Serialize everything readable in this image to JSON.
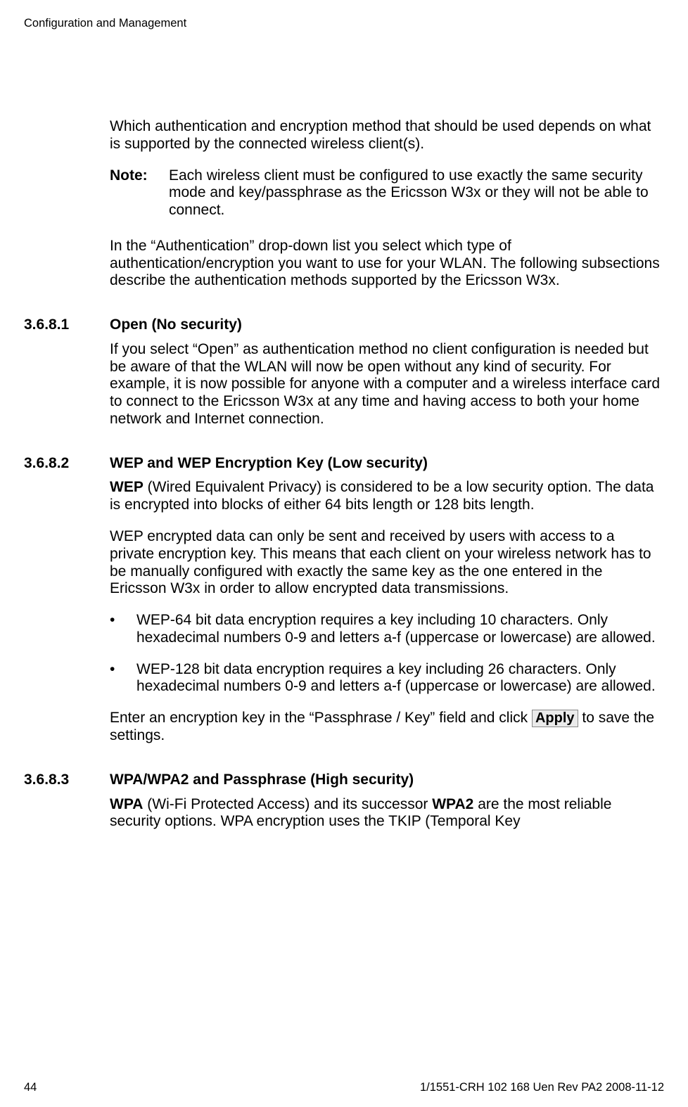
{
  "header": {
    "running": "Configuration and Management"
  },
  "intro": {
    "p1": "Which authentication and encryption method that should be used depends on what is supported by the connected wireless client(s).",
    "note_label": "Note:",
    "note_body": "Each wireless client must be configured to use exactly the same security mode and key/passphrase as the Ericsson W3x or they will not be able to connect.",
    "p2": "In the “Authentication” drop-down list you select which type of authentication/encryption you want to use for your WLAN. The following subsections describe the authentication methods supported by the Ericsson W3x."
  },
  "s3681": {
    "num": "3.6.8.1",
    "title": "Open (No security)",
    "p1": "If you select “Open” as authentication method no client configuration is needed but be aware of that the WLAN will now be open without any kind of security. For example, it is now possible for anyone with a computer and a wireless interface card to connect to the Ericsson W3x at any time and having access to both your home network and Internet connection."
  },
  "s3682": {
    "num": "3.6.8.2",
    "title": "WEP and WEP Encryption Key (Low security)",
    "p1_bold": "WEP",
    "p1_rest": " (Wired Equivalent Privacy) is considered to be a low security option. The data is encrypted into blocks of either 64 bits length or 128 bits length.",
    "p2": "WEP encrypted data can only be sent and received by users with access to a private encryption key. This means that each client on your wireless network has to be manually configured with exactly the same key as the one entered in the Ericsson W3x in order to allow encrypted data transmissions.",
    "b1": "WEP-64 bit data encryption requires a key including 10 characters. Only hexadecimal numbers 0-9 and letters a-f (uppercase or lowercase) are allowed.",
    "b2": "WEP-128 bit data encryption requires a key including 26 characters. Only hexadecimal numbers 0-9 and letters a-f (uppercase or lowercase) are allowed.",
    "p3_pre": "Enter an encryption key in the “Passphrase / Key” field and click ",
    "apply_label": "Apply",
    "p3_post": " to save the settings."
  },
  "s3683": {
    "num": "3.6.8.3",
    "title": "WPA/WPA2 and Passphrase (High security)",
    "p1_b1": "WPA",
    "p1_mid": " (Wi-Fi Protected Access) and its successor ",
    "p1_b2": "WPA2",
    "p1_end": " are the most reliable security options. WPA encryption uses the TKIP (Temporal Key"
  },
  "footer": {
    "page": "44",
    "docid": "1/1551-CRH 102 168 Uen Rev PA2  2008-11-12"
  }
}
